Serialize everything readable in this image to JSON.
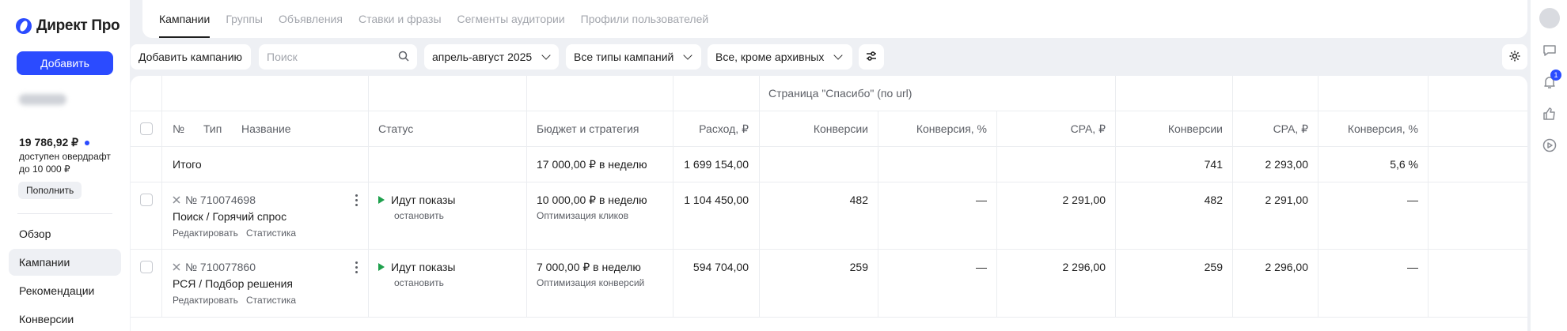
{
  "sidebar": {
    "logo": "Директ Про",
    "add_button": "Добавить",
    "balance": "19 786,92 ₽",
    "overdraft": "доступен овердрафт до 10 000 ₽",
    "topup_button": "Пополнить",
    "nav": [
      "Обзор",
      "Кампании",
      "Рекомендации",
      "Конверсии"
    ],
    "active_nav": "Кампании"
  },
  "tabs": [
    "Кампании",
    "Группы",
    "Объявления",
    "Ставки и фразы",
    "Сегменты аудитории",
    "Профили пользователей"
  ],
  "toolbar": {
    "add_campaign": "Добавить кампанию",
    "search_placeholder": "Поиск",
    "period": "апрель-август 2025",
    "campaign_types": "Все типы кампаний",
    "archive_filter": "Все, кроме архивных"
  },
  "table": {
    "group_header": "Страница \"Спасибо\" (по url)",
    "headers": {
      "number": "№",
      "type": "Тип",
      "name": "Название",
      "status": "Статус",
      "budget": "Бюджет и стратегия",
      "spend": "Расход, ₽",
      "conversions_1": "Конверсии",
      "conv_rate_1": "Конверсия, %",
      "cpa_1": "CPA, ₽",
      "conversions_2": "Конверсии",
      "cpa_2": "CPA, ₽",
      "conv_rate_2": "Конверсия, %"
    },
    "total": {
      "label": "Итого",
      "budget": "17 000,00 ₽ в неделю",
      "spend": "1 699 154,00",
      "conversions_2": "741",
      "cpa_2": "2 293,00",
      "conv_rate_2": "5,6 %"
    },
    "rows": [
      {
        "id": "№ 710074698",
        "name": "Поиск / Горячий спрос",
        "edit": "Редактировать",
        "stats": "Статистика",
        "status": "Идут показы",
        "status_action": "остановить",
        "budget": "10 000,00 ₽ в неделю",
        "strategy": "Оптимизация кликов",
        "spend": "1 104 450,00",
        "conversions_1": "482",
        "conv_rate_1": "—",
        "cpa_1": "2 291,00",
        "conversions_2": "482",
        "cpa_2": "2 291,00",
        "conv_rate_2": "—"
      },
      {
        "id": "№ 710077860",
        "name": "РСЯ / Подбор решения",
        "edit": "Редактировать",
        "stats": "Статистика",
        "status": "Идут показы",
        "status_action": "остановить",
        "budget": "7 000,00 ₽ в неделю",
        "strategy": "Оптимизация конверсий",
        "spend": "594 704,00",
        "conversions_1": "259",
        "conv_rate_1": "—",
        "cpa_1": "2 296,00",
        "conversions_2": "259",
        "cpa_2": "2 296,00",
        "conv_rate_2": "—"
      }
    ]
  },
  "colors": {
    "accent": "#2b4bff",
    "status_green": "#1ea04c"
  },
  "right_rail": {
    "notification_count": "1"
  }
}
